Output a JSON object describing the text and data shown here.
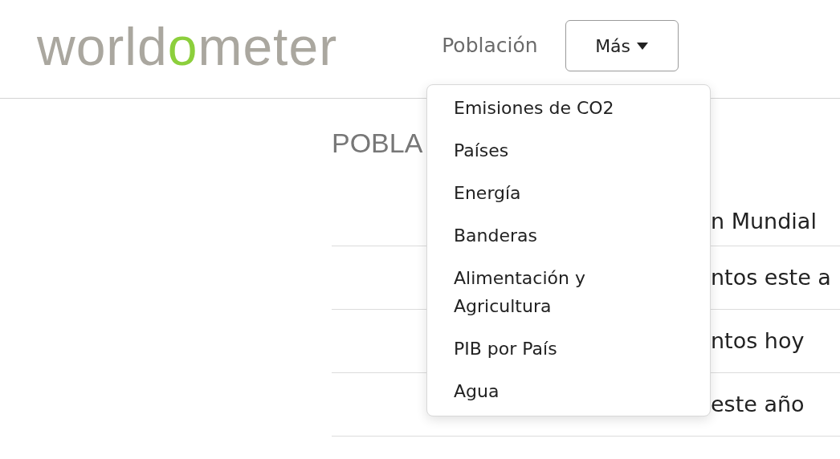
{
  "logo": {
    "before": "world",
    "accent": "o",
    "after": "meter"
  },
  "nav": {
    "link": "Población",
    "more_button": {
      "label": "Más",
      "expanded": true
    }
  },
  "dropdown": {
    "items": [
      {
        "label": "Emisiones de CO2"
      },
      {
        "label": "Países"
      },
      {
        "label": "Energía"
      },
      {
        "label": "Banderas"
      },
      {
        "label": "Alimentación y Agricultura"
      },
      {
        "label": "PIB por País"
      },
      {
        "label": "Agua"
      }
    ]
  },
  "content": {
    "heading": "POBLA",
    "rows": [
      "n Mundial",
      "ntos este a",
      "ntos hoy",
      "este año"
    ]
  }
}
